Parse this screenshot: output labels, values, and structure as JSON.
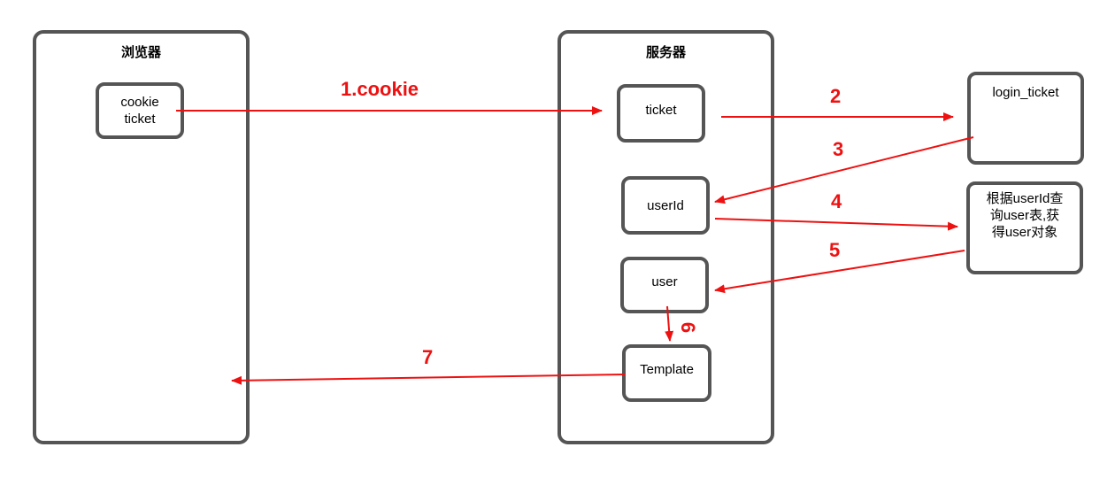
{
  "containers": {
    "browser": "浏览器",
    "server": "服务器"
  },
  "boxes": {
    "cookie_ticket_line1": "cookie",
    "cookie_ticket_line2": "ticket",
    "ticket": "ticket",
    "userid": "userId",
    "user": "user",
    "template": "Template",
    "login_ticket": "login_ticket",
    "lookup_line1": "根据userId查",
    "lookup_line2": "询user表,获",
    "lookup_line3": "得user对象"
  },
  "steps": {
    "s1": "1.cookie",
    "s2": "2",
    "s3": "3",
    "s4": "4",
    "s5": "5",
    "s6": "6",
    "s7": "7"
  },
  "colors": {
    "arrow": "#ee1111",
    "border": "#555555"
  }
}
